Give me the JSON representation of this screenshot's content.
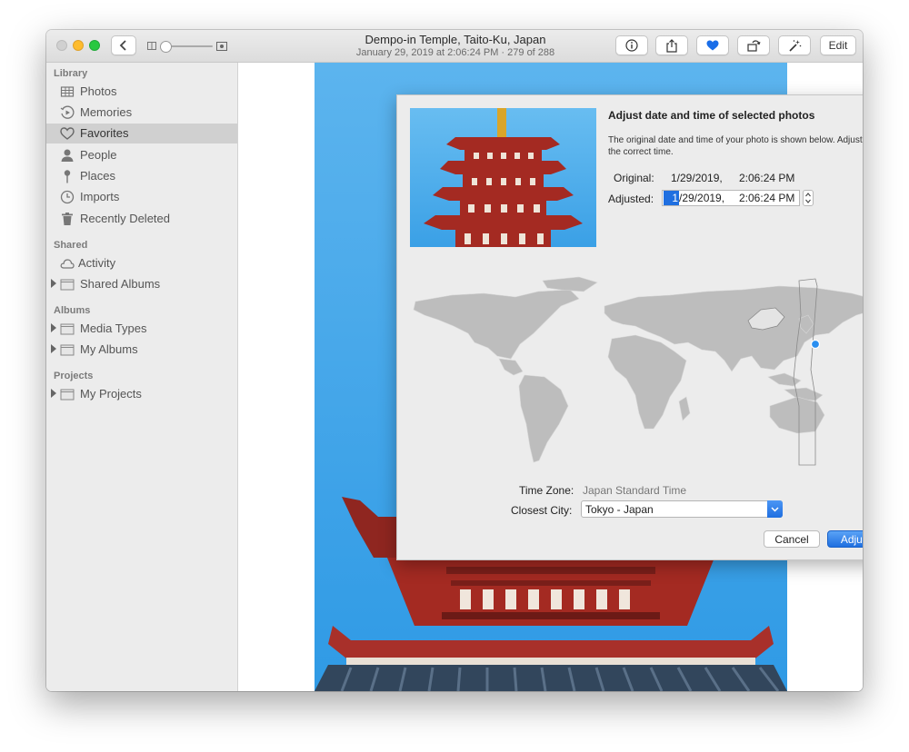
{
  "window": {
    "title": "Dempo-in Temple, Taito-Ku, Japan",
    "subtitle": "January 29, 2019 at 2:06:24 PM  ·  279 of 288"
  },
  "toolbar": {
    "edit_label": "Edit",
    "zoom_level": 0.1,
    "icons": [
      "back-chevron-icon",
      "zoom-slider",
      "info-icon",
      "share-icon",
      "heart-icon",
      "rotate-icon",
      "magic-wand-icon"
    ]
  },
  "colors": {
    "accent": "#1f6fe0",
    "favorite": "#1a6ee8",
    "sky": "#3aa0e6",
    "pagoda_red": "#a42a22"
  },
  "sidebar": {
    "sections": [
      {
        "title": "Library",
        "items": [
          {
            "label": "Photos",
            "icon": "photos-icon"
          },
          {
            "label": "Memories",
            "icon": "memories-icon"
          },
          {
            "label": "Favorites",
            "icon": "heart-icon",
            "selected": true
          },
          {
            "label": "People",
            "icon": "person-icon"
          },
          {
            "label": "Places",
            "icon": "pin-icon"
          },
          {
            "label": "Imports",
            "icon": "clock-icon"
          },
          {
            "label": "Recently Deleted",
            "icon": "trash-icon"
          }
        ]
      },
      {
        "title": "Shared",
        "items": [
          {
            "label": "Activity",
            "icon": "cloud-icon"
          },
          {
            "label": "Shared Albums",
            "icon": "folder-icon"
          }
        ]
      },
      {
        "title": "Albums",
        "items": [
          {
            "label": "Media Types",
            "icon": "folder-icon"
          },
          {
            "label": "My Albums",
            "icon": "folder-icon"
          }
        ]
      },
      {
        "title": "Projects",
        "items": [
          {
            "label": "My Projects",
            "icon": "folder-icon"
          }
        ]
      }
    ]
  },
  "dialog": {
    "title": "Adjust date and time of selected photos",
    "description": "The original date and time of your photo is shown below. Adjust it to the correct time.",
    "original_label": "Original:",
    "original_date": "1/29/2019,",
    "original_time": "2:06:24 PM",
    "adjusted_label": "Adjusted:",
    "adjusted_month": "1",
    "adjusted_date_rest": "/29/2019,",
    "adjusted_time": "2:06:24 PM",
    "timezone_label": "Time Zone:",
    "timezone_value": "Japan Standard Time",
    "city_label": "Closest City:",
    "city_value": "Tokyo - Japan",
    "cancel_label": "Cancel",
    "adjust_label": "Adjust"
  }
}
